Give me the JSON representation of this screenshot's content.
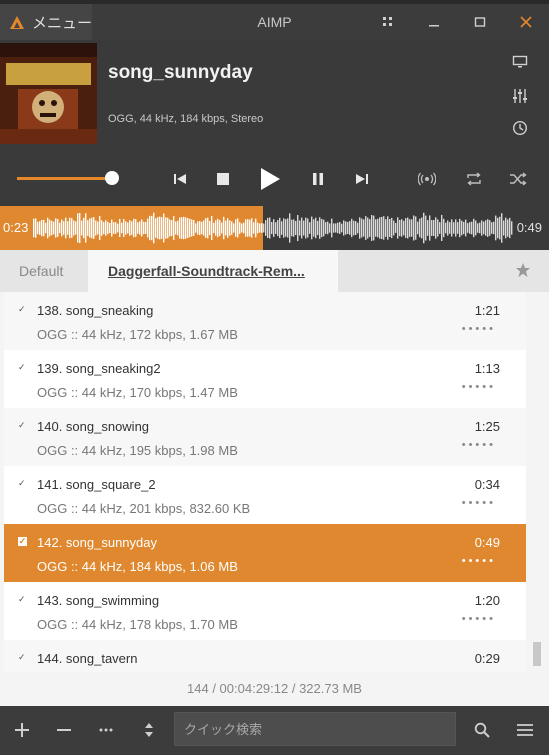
{
  "titlebar": {
    "menu_label": "メニュー",
    "app_title": "AIMP",
    "icons": [
      "grid-icon",
      "minimize-icon",
      "maximize-icon",
      "close-icon"
    ]
  },
  "now_playing": {
    "title": "song_sunnyday",
    "info": "OGG, 44 kHz, 184 kbps, Stereo",
    "cover_text": "DAGGERFALL"
  },
  "controls": {
    "volume_level": 0.85,
    "icons": [
      "previous-icon",
      "stop-icon",
      "play-icon",
      "pause-icon",
      "next-icon",
      "surround-icon",
      "repeat-icon",
      "shuffle-icon"
    ]
  },
  "waveform": {
    "elapsed": "0:23",
    "total": "0:49",
    "progress": 0.47
  },
  "tabs": {
    "default_label": "Default",
    "active_label": "Daggerfall-Soundtrack-Rem..."
  },
  "playlist": {
    "rows": [
      {
        "title": "138. song_sneaking",
        "duration": "1:21",
        "info": "OGG :: 44 kHz, 172 kbps, 1.67 MB",
        "active": false
      },
      {
        "title": "139. song_sneaking2",
        "duration": "1:13",
        "info": "OGG :: 44 kHz, 170 kbps, 1.47 MB",
        "active": false
      },
      {
        "title": "140. song_snowing",
        "duration": "1:25",
        "info": "OGG :: 44 kHz, 195 kbps, 1.98 MB",
        "active": false
      },
      {
        "title": "141. song_square_2",
        "duration": "0:34",
        "info": "OGG :: 44 kHz, 201 kbps, 832.60 KB",
        "active": false
      },
      {
        "title": "142. song_sunnyday",
        "duration": "0:49",
        "info": "OGG :: 44 kHz, 184 kbps, 1.06 MB",
        "active": true
      },
      {
        "title": "143. song_swimming",
        "duration": "1:20",
        "info": "OGG :: 44 kHz, 178 kbps, 1.70 MB",
        "active": false
      },
      {
        "title": "144. song_tavern",
        "duration": "0:29",
        "info": "",
        "active": false
      }
    ],
    "summary": "144 / 00:04:29:12 / 322.73 MB"
  },
  "bottombar": {
    "search_placeholder": "クイック検索",
    "icons": [
      "add-icon",
      "remove-icon",
      "more-icon",
      "sort-icon",
      "search-icon",
      "menu-icon"
    ]
  },
  "colors": {
    "accent": "#e0882f",
    "dark_bg": "#3a3a3a",
    "list_bg": "#f4f4f4"
  }
}
